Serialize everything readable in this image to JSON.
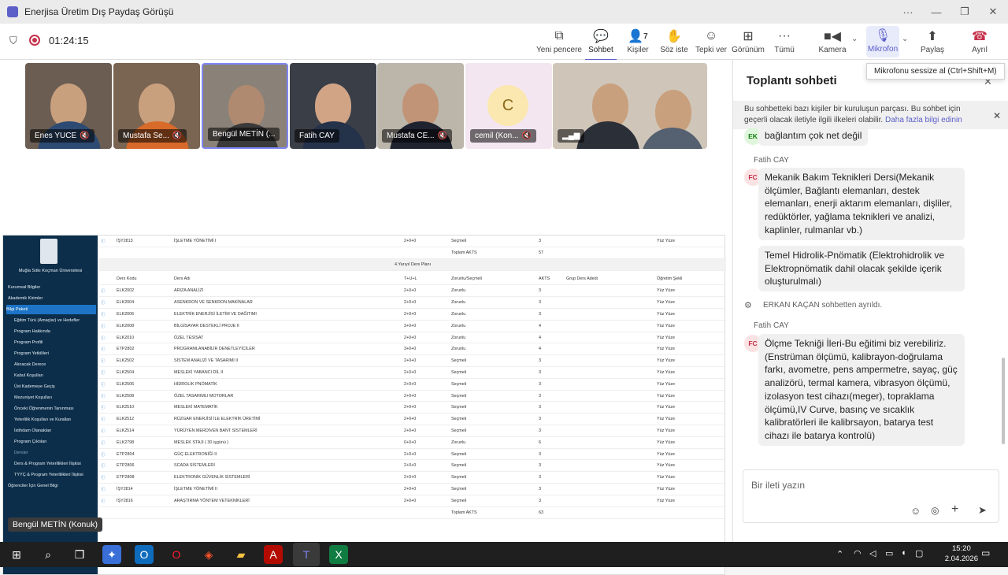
{
  "window": {
    "title": "Enerjisa Üretim Dış Paydaş Görüşü"
  },
  "toolbar": {
    "timer": "01:24:15",
    "items": [
      {
        "label": "Yeni pencere",
        "icon": "new-window-icon"
      },
      {
        "label": "Sohbet",
        "icon": "chat-icon"
      },
      {
        "label": "Kişiler",
        "icon": "people-icon",
        "count": "7"
      },
      {
        "label": "Söz iste",
        "icon": "raise-hand-icon"
      },
      {
        "label": "Tepki ver",
        "icon": "smiley-icon"
      },
      {
        "label": "Görünüm",
        "icon": "grid-icon"
      },
      {
        "label": "Tümü",
        "icon": "more-icon"
      },
      {
        "label": "Kamera",
        "icon": "camera-icon"
      },
      {
        "label": "Mikrofon",
        "icon": "microphone-icon"
      },
      {
        "label": "Paylaş",
        "icon": "share-icon"
      },
      {
        "label": "Ayrıl",
        "icon": "hang-up-icon"
      }
    ],
    "mic_tooltip": "Mikrofonu sessize al (Ctrl+Shift+M)"
  },
  "participants": [
    {
      "name": "Enes YUCE"
    },
    {
      "name": "Mustafa Se..."
    },
    {
      "name": "Bengül METİN (..."
    },
    {
      "name": "Fatih CAY"
    },
    {
      "name": "Mustafa CE..."
    },
    {
      "name": "cemil (Kon...",
      "initial": "C"
    },
    {
      "name": ""
    }
  ],
  "hover_name": "Bengül METİN (Konuk)",
  "lms": {
    "university": "Muğla Sıtkı Koçman Üniversitesi",
    "sidebar": [
      "Kurumsal Bilgiler",
      "Akademik Kirimler",
      "Bilgi Paketi",
      "Eğitim Türü (Amaçlar) ve Hedefler",
      "Program Hakkında",
      "Program Profili",
      "Program Yetkilileri",
      "Alınacak Derece",
      "Kabul Koşulları",
      "Üst Kademeye Geçiş",
      "Mezuniyet Koşulları",
      "Önceki Öğrenmenin Tanınması",
      "Yeterlilik Koşulları ve Kuralları",
      "İstihdam Olanakları",
      "Program Çıktıları",
      "Dersler",
      "Ders & Program Yeterlilikleri İlişkisi",
      "TYYÇ & Program Yeterlilikleri İlişkisi",
      "Öğrenciler İçin Genel Bilgi"
    ],
    "top_row": {
      "code": "İŞY2813",
      "name": "İŞLETME YÖNETİMİ I",
      "thu": "2+0+0",
      "type": "Seçmeli",
      "akts": "3",
      "mode": "Yüz Yüze"
    },
    "top_total": {
      "label": "Toplam AKTS",
      "value": "57"
    },
    "plan_title": "4.Yarıyıl Ders Planı",
    "headers": [
      "Ders Kodu",
      "Ders Adı",
      "T+U+L",
      "Zorunlu/Seçmeli",
      "AKTS",
      "Grup Ders Adedi",
      "Öğretim Şekli"
    ],
    "rows": [
      [
        "ELK2002",
        "ARIZA ANALİZİ",
        "2+0+0",
        "Zorunlu",
        "3",
        "Yüz Yüze"
      ],
      [
        "ELK2004",
        "ASENKRON VE SENKRON MAKİNALAR",
        "2+0+0",
        "Zorunlu",
        "3",
        "Yüz Yüze"
      ],
      [
        "ELK2006",
        "ELEKTRİK ENERJİSİ İLETİM VE DAĞITIMI",
        "2+0+0",
        "Zorunlu",
        "3",
        "Yüz Yüze"
      ],
      [
        "ELK2008",
        "BİLGİSAYAR DESTEKLİ PROJE II",
        "3+0+0",
        "Zorunlu",
        "4",
        "Yüz Yüze"
      ],
      [
        "ELK2010",
        "ÖZEL TESİSAT",
        "2+0+0",
        "Zorunlu",
        "4",
        "Yüz Yüze"
      ],
      [
        "ETP2802",
        "PROGRAMLANABİLİR DENETLEYİCİLER",
        "3+0+0",
        "Zorunlu",
        "4",
        "Yüz Yüze"
      ],
      [
        "ELK2502",
        "SİSTEM ANALİZİ VE TASARIMI II",
        "2+0+0",
        "Seçmeli",
        "3",
        "Yüz Yüze"
      ],
      [
        "ELK2504",
        "MESLEKİ YABANCI DİL II",
        "2+0+0",
        "Seçmeli",
        "3",
        "Yüz Yüze"
      ],
      [
        "ELK2506",
        "HİDROLİK PNÖMATİK",
        "2+0+0",
        "Seçmeli",
        "3",
        "Yüz Yüze"
      ],
      [
        "ELK2508",
        "ÖZEL TASARIMLI MOTORLAR",
        "2+0+0",
        "Seçmeli",
        "3",
        "Yüz Yüze"
      ],
      [
        "ELK2510",
        "MESLEKİ MATEMATİK",
        "2+0+0",
        "Seçmeli",
        "3",
        "Yüz Yüze"
      ],
      [
        "ELK2512",
        "RÜZGAR ENERJİSİ İLE ELEKTRİK ÜRETİMİ",
        "2+0+0",
        "Seçmeli",
        "3",
        "Yüz Yüze"
      ],
      [
        "ELK2514",
        "YÜRÜYEN MERDİVEN BANT SİSTEMLERİ",
        "2+0+0",
        "Seçmeli",
        "3",
        "Yüz Yüze"
      ],
      [
        "ELK2798",
        "MESLEK STAJI ( 30 işgünü )",
        "0+0+0",
        "Zorunlu",
        "6",
        "Yüz Yüze"
      ],
      [
        "ETP2804",
        "GÜÇ ELEKTRONİĞİ II",
        "2+0+0",
        "Seçmeli",
        "3",
        "Yüz Yüze"
      ],
      [
        "ETP2806",
        "SCADA SİSTEMLERİ",
        "2+0+0",
        "Seçmeli",
        "3",
        "Yüz Yüze"
      ],
      [
        "ETP2808",
        "ELEKTRONİK GÜVENLİK SİSTEMLERİ",
        "2+0+0",
        "Seçmeli",
        "3",
        "Yüz Yüze"
      ],
      [
        "İŞY2814",
        "İŞLETME YÖNETİMİ II",
        "2+0+0",
        "Seçmeli",
        "3",
        "Yüz Yüze"
      ],
      [
        "İŞY2816",
        "ARAŞTIRMA YÖNTEM VETEKNİKLERİ",
        "2+0+0",
        "Seçmeli",
        "3",
        "Yüz Yüze"
      ]
    ],
    "bottom_total": {
      "label": "Toplam AKTS",
      "value": "63"
    }
  },
  "chat": {
    "title": "Toplantı sohbeti",
    "notice": "Bu sohbetteki bazı kişiler bir kuruluşun parçası. Bu sohbet için geçerli olacak iletiyle ilgili ilkeleri olabilir.",
    "notice_link": "Daha fazla bilgi edinin",
    "first_initials": "EK",
    "first_msg": "bağlantım çok net değil",
    "sender1": "Fatih CAY",
    "initials1": "FC",
    "msg1": "Mekanik Bakım Teknikleri Dersi(Mekanik ölçümler, Bağlantı elemanları, destek elemanları, enerji aktarım elemanları, dişliler, redüktörler, yağlama teknikleri ve analizi, kaplinler, rulmanlar vb.)",
    "msg2": "Temel Hidrolik-Pnömatik (Elektrohidrolik ve Elektropnömatik dahil olacak şekilde içerik oluşturulmalı)",
    "system_msg": "ERKAN KAÇAN sohbetten ayrıldı.",
    "sender2": "Fatih CAY",
    "initials2": "FC",
    "msg3": "Ölçme Tekniği İleri-Bu eğitimi biz verebiliriz. (Enstrüman ölçümü, kalibrayon-doğrulama farkı, avometre, pens ampermetre, sayaç, güç analizörü, termal kamera, vibrasyon ölçümü, izolasyon test cihazı(meger), topraklama ölçümü,IV Curve, basınç ve sıcaklık kalibratörleri ile kalibrsayon, batarya test cihazı ile batarya kontrolü)",
    "compose_placeholder": "Bir ileti yazın"
  },
  "taskbar": {
    "time": "15:20",
    "date": "2.04.2026"
  }
}
